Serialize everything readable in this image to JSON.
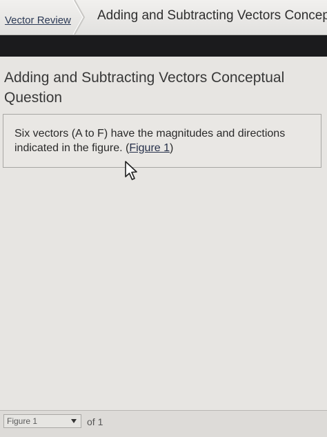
{
  "breadcrumb": {
    "parent_label": "Vector Review",
    "current_label": "Adding and Subtracting Vectors Concept"
  },
  "main": {
    "title": "Adding and Subtracting Vectors Conceptual Question",
    "question": {
      "text_before": "Six vectors (A to F) have the magnitudes and directions indicated in the figure. (",
      "link_label": "Figure 1",
      "text_after": ")"
    }
  },
  "figure_bar": {
    "selected": "Figure 1",
    "of_text": "of 1"
  },
  "icons": {
    "separator": "chevron-right-icon",
    "dropdown": "chevron-down-icon",
    "cursor": "mouse-pointer-icon"
  }
}
